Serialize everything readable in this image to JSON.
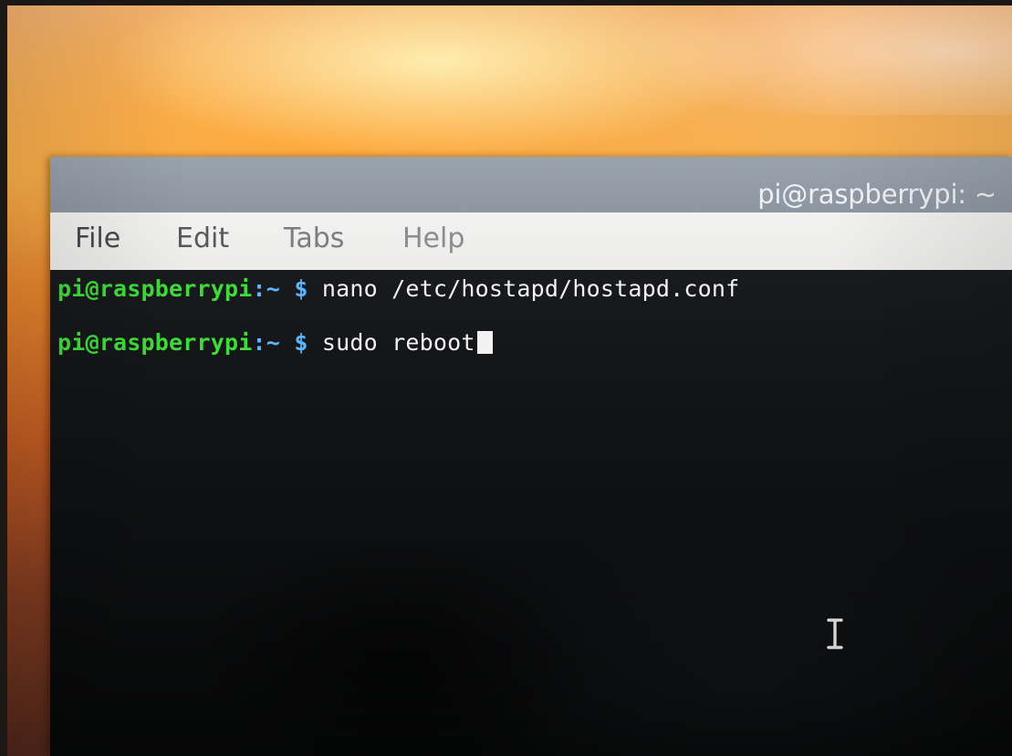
{
  "window": {
    "title": "pi@raspberrypi: ~"
  },
  "menu": {
    "items": [
      "File",
      "Edit",
      "Tabs",
      "Help"
    ]
  },
  "terminal": {
    "lines": [
      {
        "user_host": "pi@raspberrypi",
        "separator": ":",
        "path": "~",
        "sign": "$",
        "command": "nano /etc/hostapd/hostapd.conf"
      },
      {
        "user_host": "pi@raspberrypi",
        "separator": ":",
        "path": "~",
        "sign": "$",
        "command": "sudo reboot"
      }
    ]
  },
  "icons": {
    "pointer": "text-cursor-ibeam-icon",
    "caret": "terminal-block-cursor-icon"
  },
  "colors": {
    "prompt_user": "#3fdb3a",
    "prompt_path": "#5cb6ff",
    "command_text": "#f2f2f2",
    "title_bar": "#8d96a1",
    "menu_bar": "#ecebea",
    "terminal_background": "#0b0c0d"
  }
}
